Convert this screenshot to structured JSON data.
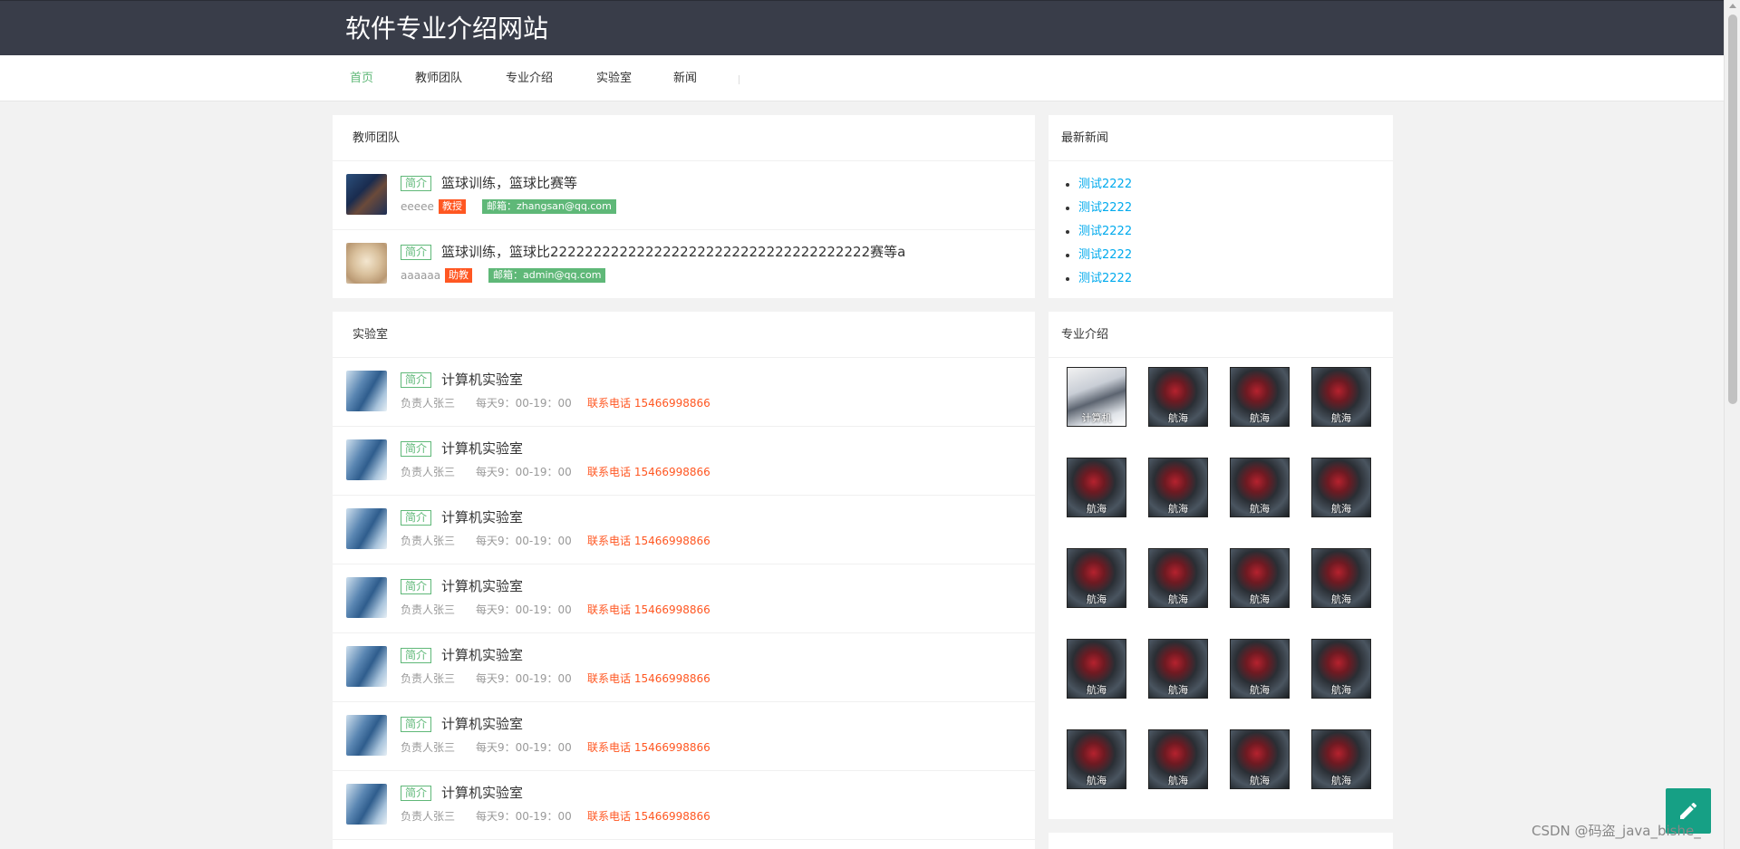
{
  "site": {
    "title": "软件专业介绍网站"
  },
  "nav": {
    "items": [
      {
        "label": "首页",
        "active": true
      },
      {
        "label": "教师团队",
        "active": false
      },
      {
        "label": "专业介绍",
        "active": false
      },
      {
        "label": "实验室",
        "active": false
      },
      {
        "label": "新闻",
        "active": false
      }
    ]
  },
  "teachers": {
    "heading": "教师团队",
    "items": [
      {
        "badge": "简介",
        "title": "篮球训练，篮球比赛等",
        "name": "eeeee",
        "rank": "教授",
        "email": "邮箱：zhangsan@qq.com",
        "image": "teacher-photo-1"
      },
      {
        "badge": "简介",
        "title": "篮球训练，篮球比2222222222222222222222222222222222222赛等a",
        "name": "aaaaaa",
        "rank": "助教",
        "email": "邮箱：admin@qq.com",
        "image": "teacher-photo-2"
      }
    ]
  },
  "labs": {
    "heading": "实验室",
    "items": [
      {
        "badge": "简介",
        "title": "计算机实验室",
        "owner": "负责人张三",
        "hours": "每天9：00-19：00",
        "phone": "联系电话 15466998866"
      },
      {
        "badge": "简介",
        "title": "计算机实验室",
        "owner": "负责人张三",
        "hours": "每天9：00-19：00",
        "phone": "联系电话 15466998866"
      },
      {
        "badge": "简介",
        "title": "计算机实验室",
        "owner": "负责人张三",
        "hours": "每天9：00-19：00",
        "phone": "联系电话 15466998866"
      },
      {
        "badge": "简介",
        "title": "计算机实验室",
        "owner": "负责人张三",
        "hours": "每天9：00-19：00",
        "phone": "联系电话 15466998866"
      },
      {
        "badge": "简介",
        "title": "计算机实验室",
        "owner": "负责人张三",
        "hours": "每天9：00-19：00",
        "phone": "联系电话 15466998866"
      },
      {
        "badge": "简介",
        "title": "计算机实验室",
        "owner": "负责人张三",
        "hours": "每天9：00-19：00",
        "phone": "联系电话 15466998866"
      },
      {
        "badge": "简介",
        "title": "计算机实验室",
        "owner": "负责人张三",
        "hours": "每天9：00-19：00",
        "phone": "联系电话 15466998866"
      }
    ]
  },
  "news": {
    "heading": "最新新闻",
    "items": [
      "测试2222",
      "测试2222",
      "测试2222",
      "测试2222",
      "测试2222"
    ]
  },
  "majors": {
    "heading": "专业介绍",
    "items": [
      "计算机",
      "航海",
      "航海",
      "航海",
      "航海",
      "航海",
      "航海",
      "航海",
      "航海",
      "航海",
      "航海",
      "航海",
      "航海",
      "航海",
      "航海",
      "航海",
      "航海",
      "航海",
      "航海",
      "航海"
    ]
  },
  "watermark": "CSDN @码盗_java_bishe_",
  "colors": {
    "header": "#393d49",
    "accent_green": "#5fb878",
    "accent_orange": "#ff5722",
    "link_blue": "#01aaed",
    "float_button": "#16a085"
  }
}
